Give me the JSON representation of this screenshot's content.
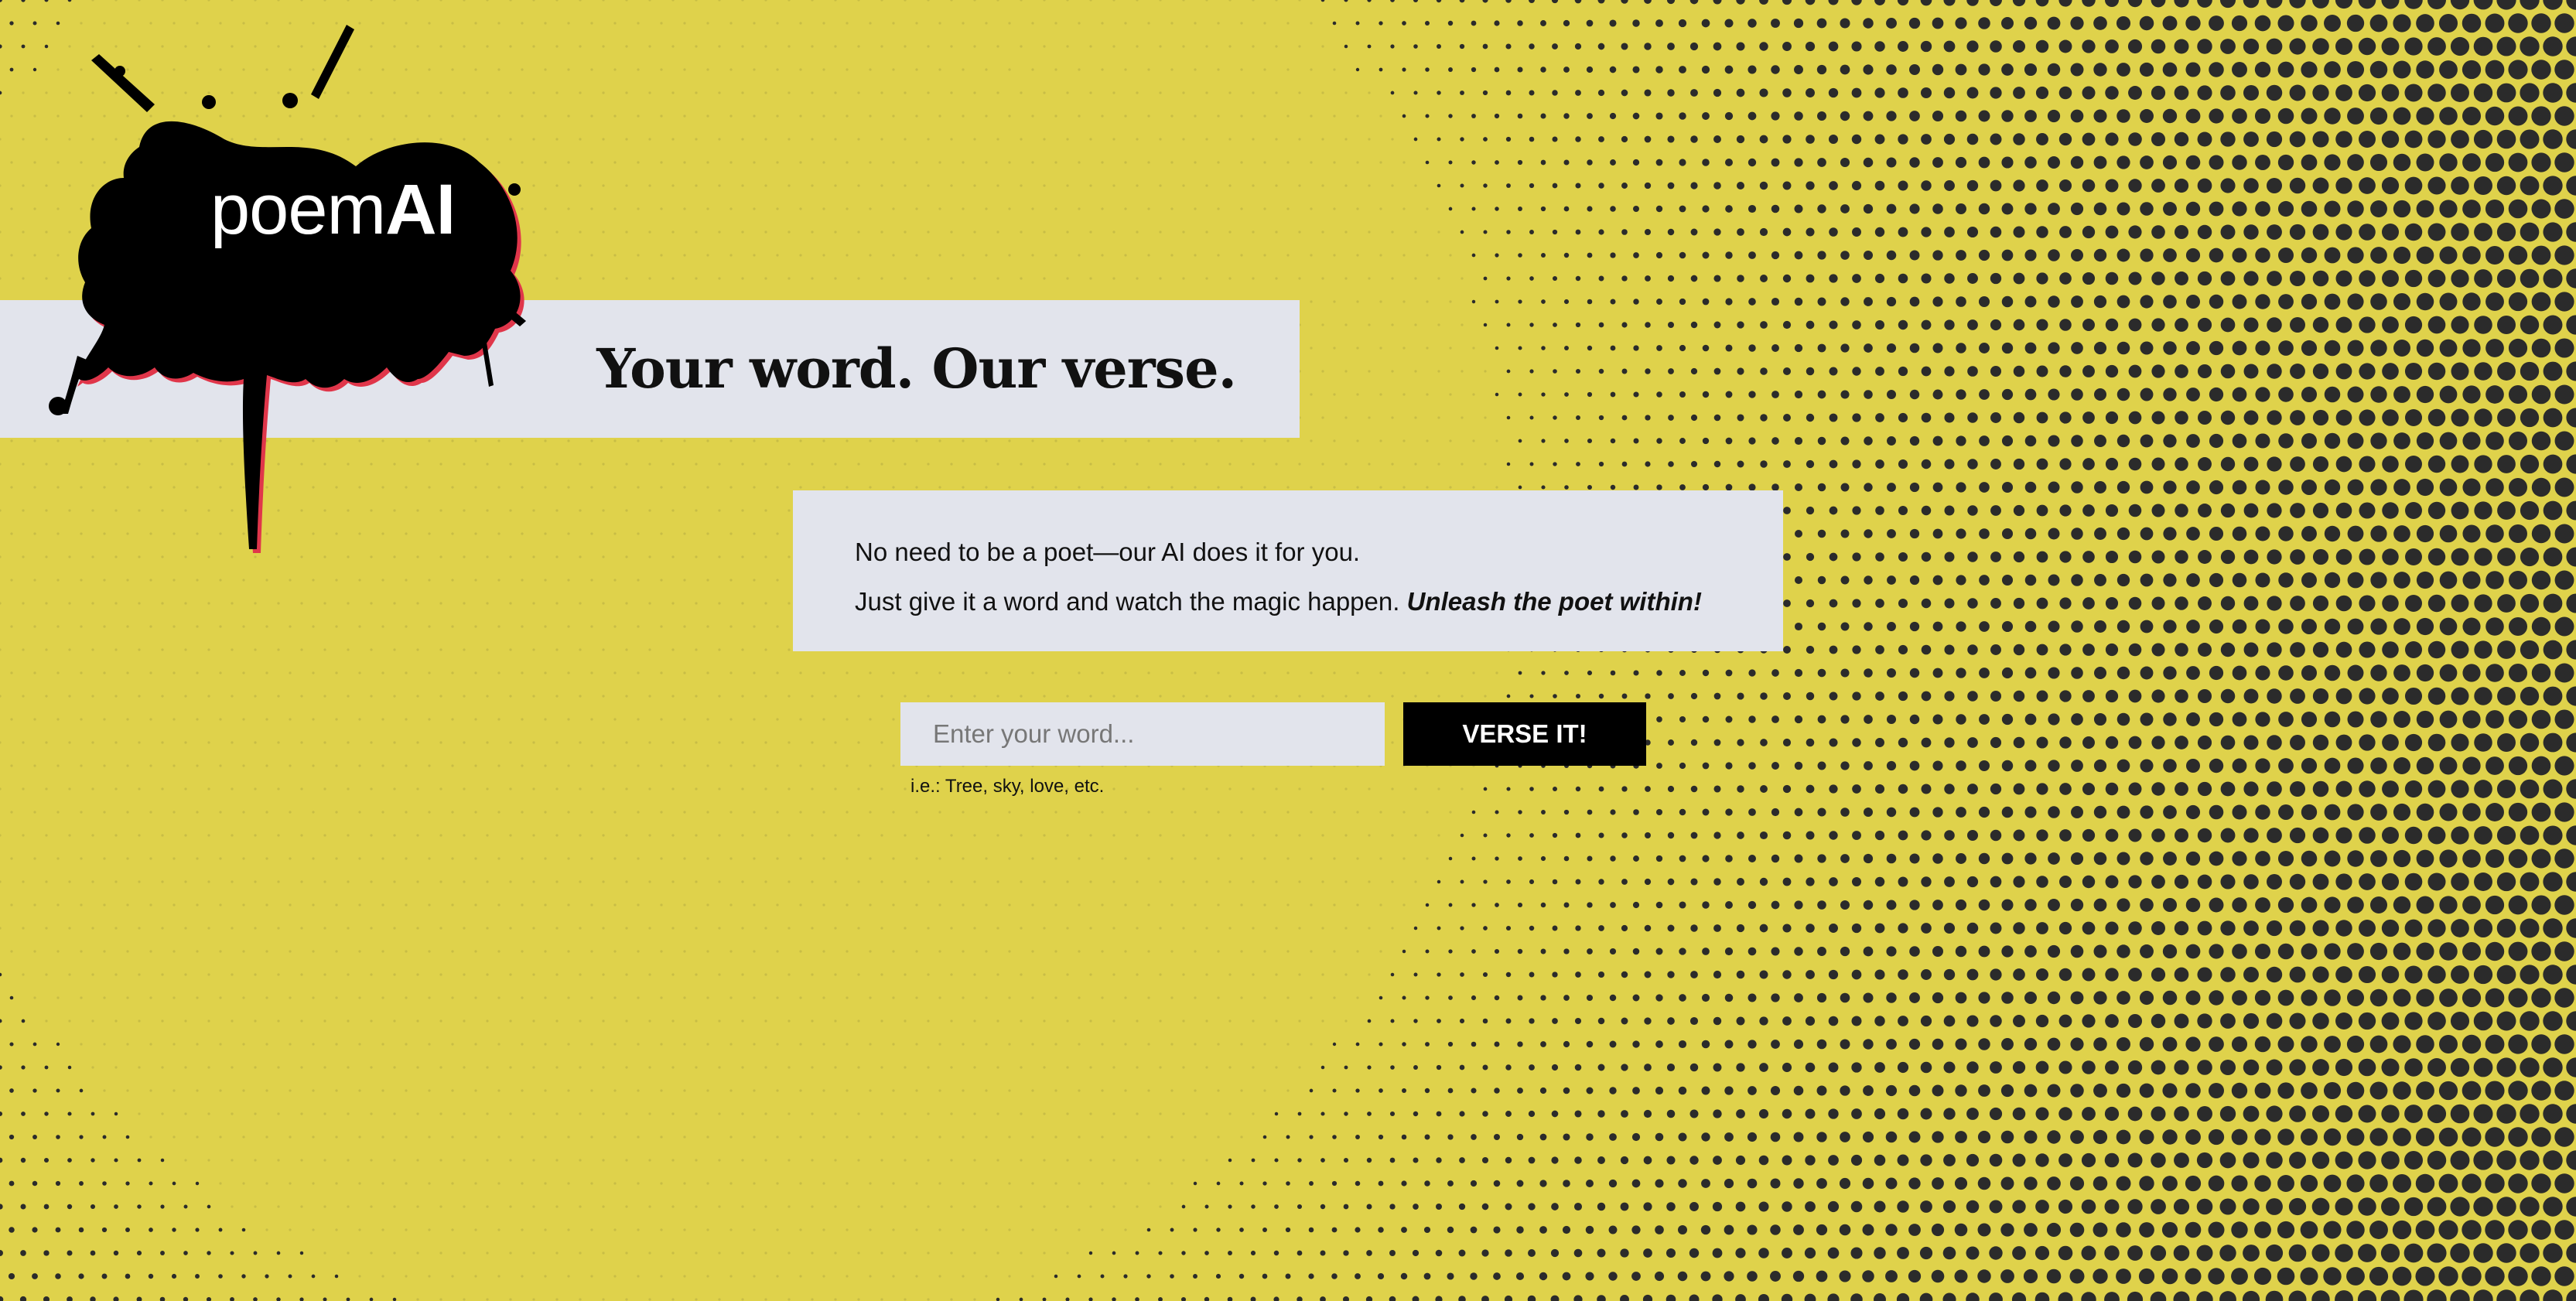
{
  "brand": {
    "logo_light": "poem",
    "logo_bold": "AI"
  },
  "hero": {
    "tagline": "Your word. Our verse."
  },
  "intro": {
    "line1": "No need to be a poet—our AI does it for you.",
    "line2": "Just give it a word and watch the magic happen.",
    "line2_emphasis": "Unleash the poet within!"
  },
  "form": {
    "placeholder": "Enter your word...",
    "value": "",
    "submit_label": "VERSE IT!",
    "hint": "i.e.: Tree, sky, love, etc."
  },
  "colors": {
    "background": "#dfd24b",
    "panel": "#e2e4ec",
    "ink": "#000000",
    "halftone_dot": "#2b2b2b",
    "splat_edge": "#e0364a"
  },
  "icons": {
    "logo_mark": "ink-splat-logo",
    "background": "halftone-dot-pattern"
  }
}
